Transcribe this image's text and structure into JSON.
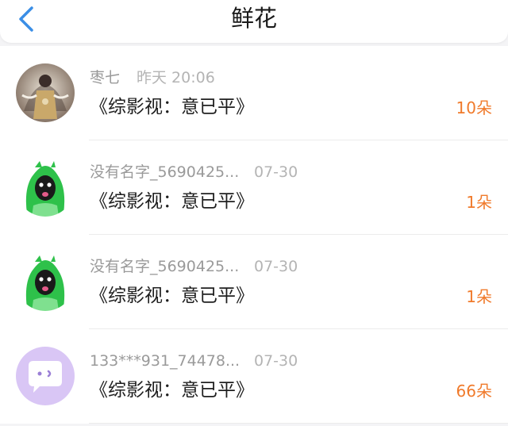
{
  "header": {
    "title": "鲜花",
    "back_icon": "chevron-left-icon",
    "accent": "#3a8ee6"
  },
  "rows": [
    {
      "avatar": "character-avatar",
      "name": "枣七",
      "time": "昨天 20:06",
      "book": "《综影视：意已平》",
      "count": "10朵"
    },
    {
      "avatar": "green-hair-avatar",
      "name": "没有名字_5690425...",
      "time": "07-30",
      "book": "《综影视：意已平》",
      "count": "1朵"
    },
    {
      "avatar": "green-hair-avatar",
      "name": "没有名字_5690425...",
      "time": "07-30",
      "book": "《综影视：意已平》",
      "count": "1朵"
    },
    {
      "avatar": "chat-bubble-avatar",
      "name": "133***931_74478...",
      "time": "07-30",
      "book": "《综影视：意已平》",
      "count": "66朵"
    }
  ],
  "colors": {
    "count": "#f07a2b",
    "avatar_purple": "#d9c6f5"
  }
}
